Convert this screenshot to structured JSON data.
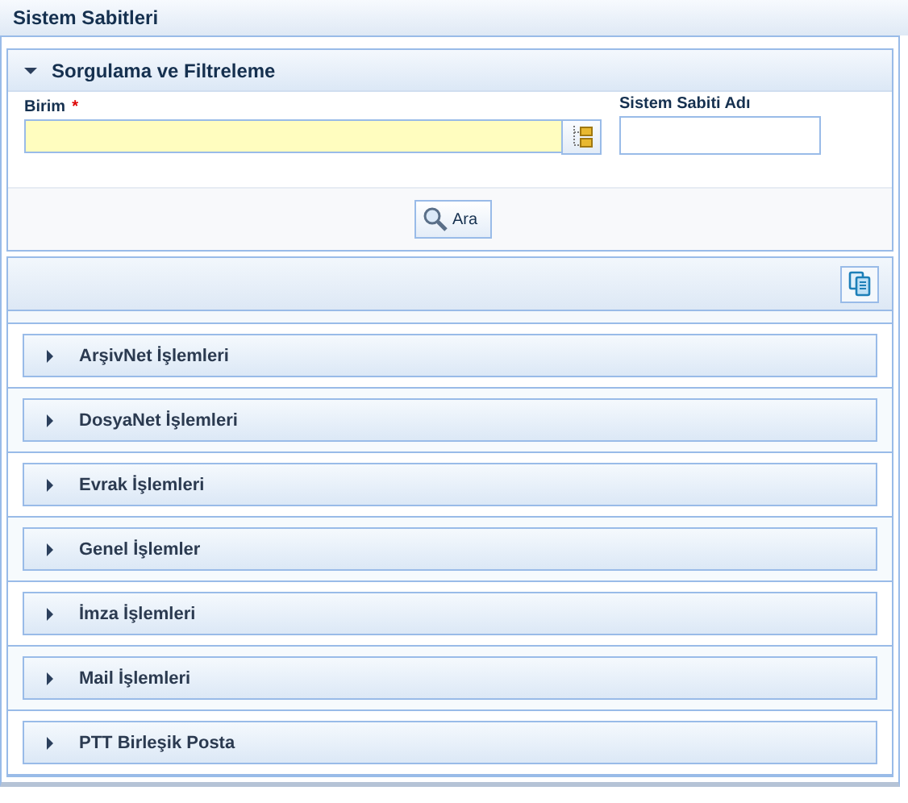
{
  "page_title": "Sistem Sabitleri",
  "search_panel": {
    "title": "Sorgulama ve Filtreleme",
    "expanded": true,
    "fields": [
      {
        "label": "Birim",
        "required": true,
        "required_mark": "*",
        "kind": "picker"
      },
      {
        "label": "Sistem Sabiti Adı",
        "required": false,
        "kind": "text"
      }
    ],
    "search_button": "Ara"
  },
  "groups": [
    {
      "title": "ArşivNet İşlemleri",
      "expanded": false
    },
    {
      "title": "DosyaNet İşlemleri",
      "expanded": false
    },
    {
      "title": "Evrak İşlemleri",
      "expanded": false
    },
    {
      "title": "Genel İşlemler",
      "expanded": false
    },
    {
      "title": "İmza İşlemleri",
      "expanded": false
    },
    {
      "title": "Mail İşlemleri",
      "expanded": false
    },
    {
      "title": "PTT Birleşik Posta",
      "expanded": false
    }
  ]
}
